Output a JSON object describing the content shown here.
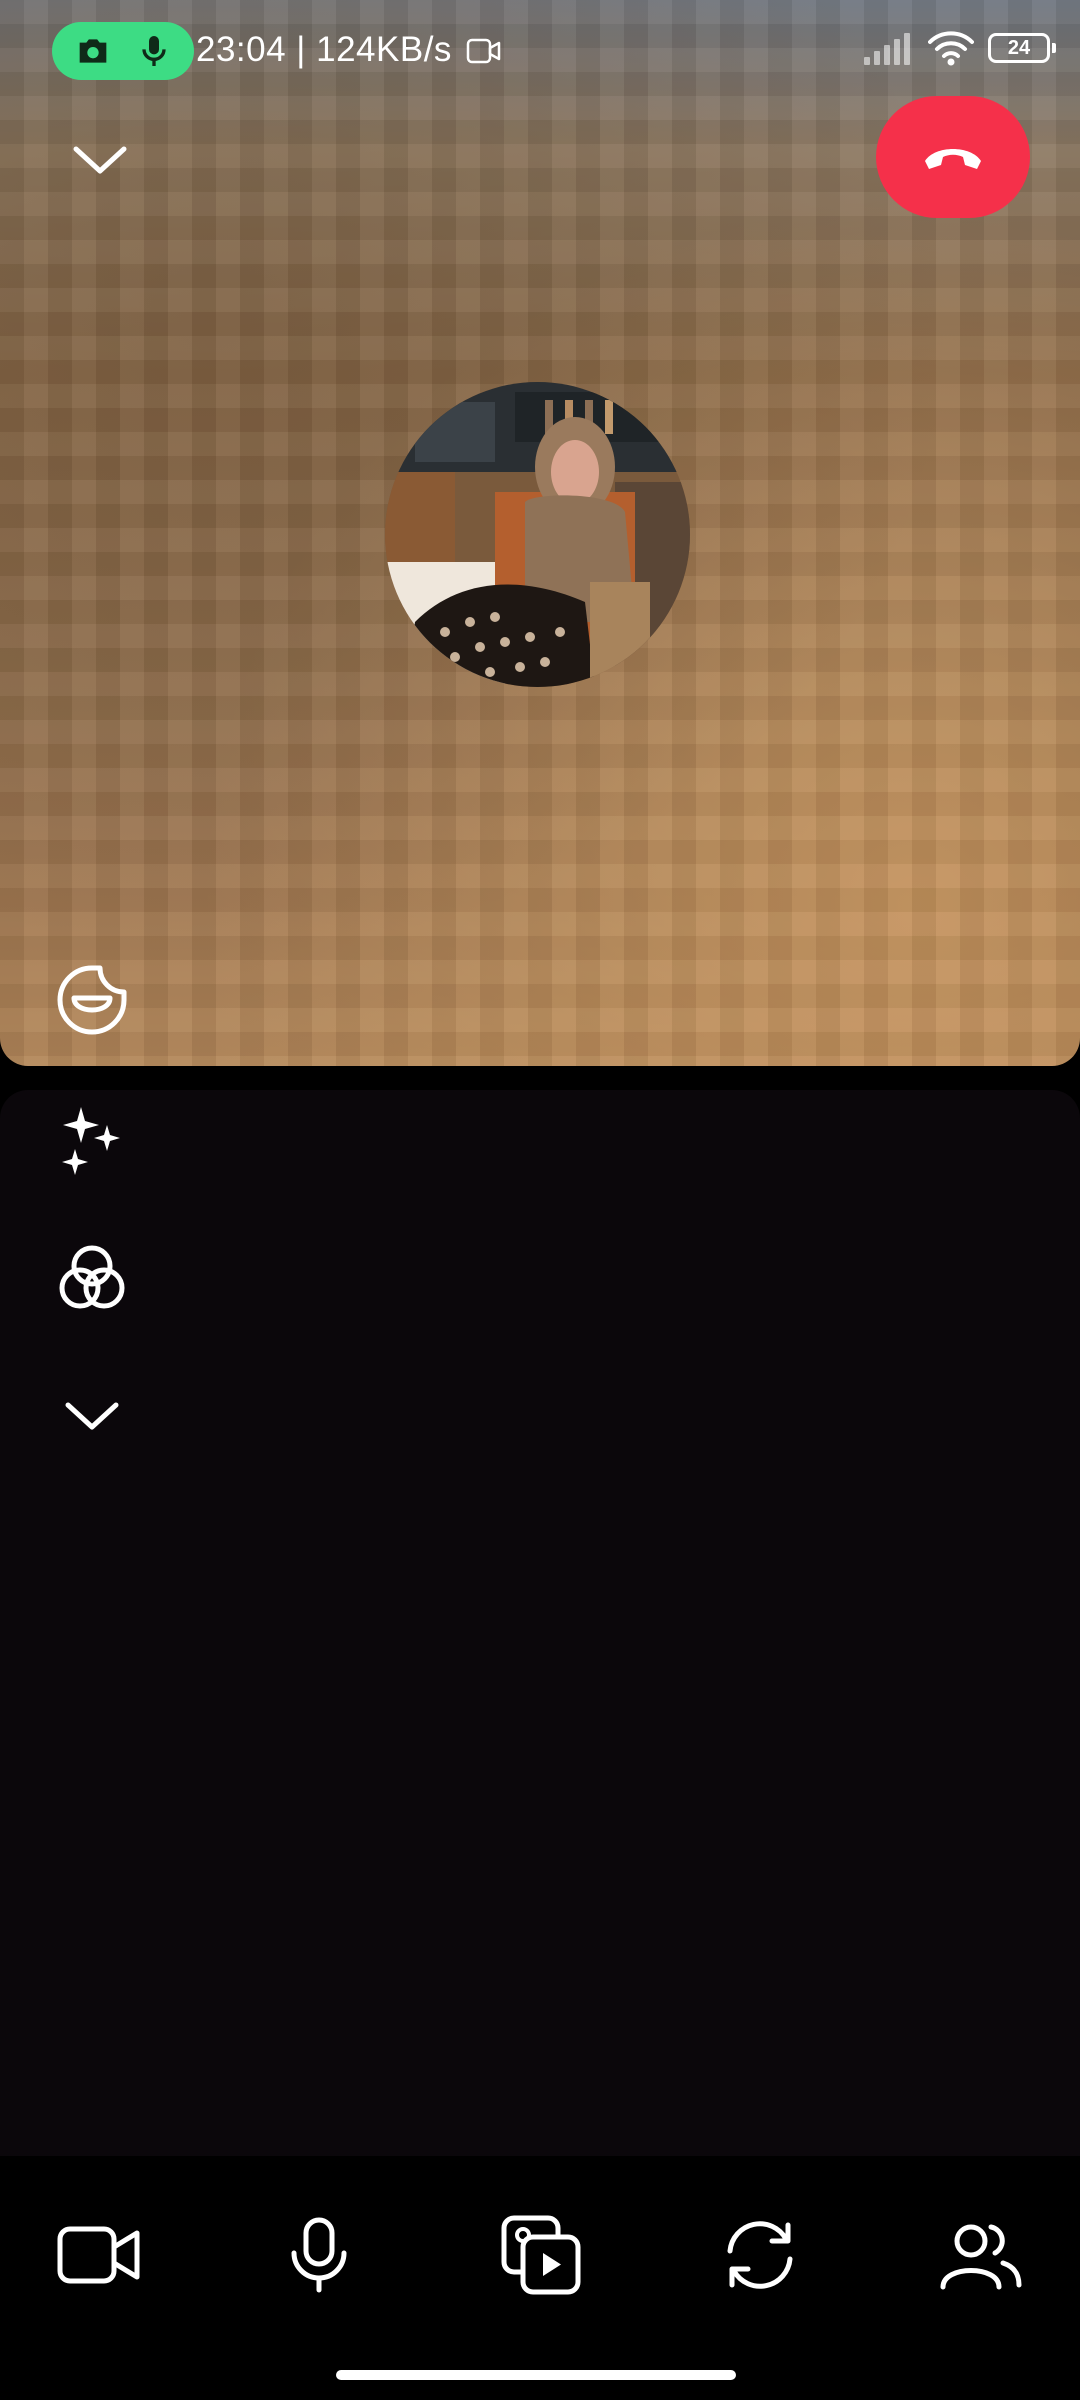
{
  "status_bar": {
    "time_speed": "23:04 | 124KB/s",
    "battery_level": "24",
    "indicator_color": "#3ddc84"
  },
  "call": {
    "end_call_color": "#f5304a",
    "avatar_description": "profile-photo"
  },
  "icons": {
    "collapse_top": "chevron-down-icon",
    "end_call": "phone-hangup-icon",
    "emoji": "sticker-emoji-icon",
    "effects": "sparkles-icon",
    "filters": "color-filter-icon",
    "collapse_tools": "chevron-down-icon",
    "video": "video-camera-icon",
    "mic": "microphone-icon",
    "media": "media-share-icon",
    "flip": "camera-flip-icon",
    "people": "add-people-icon"
  }
}
